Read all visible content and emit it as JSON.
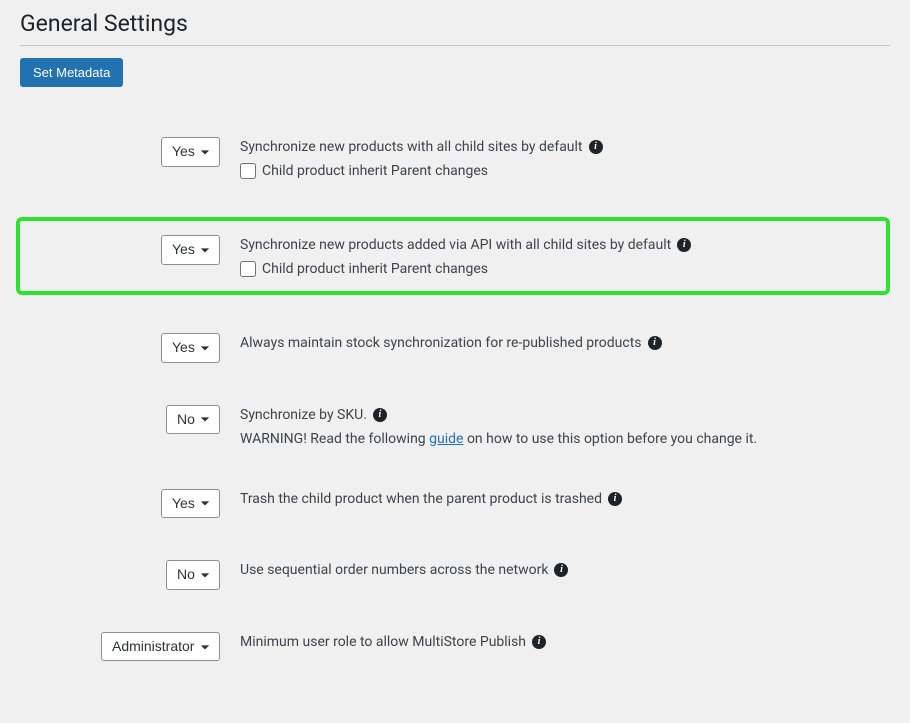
{
  "page_title": "General Settings",
  "button": {
    "set_metadata": "Set Metadata"
  },
  "select_options": {
    "yes": "Yes",
    "no": "No",
    "administrator": "Administrator"
  },
  "rows": {
    "sync_new": {
      "value": "Yes",
      "label": "Synchronize new products with all child sites by default",
      "checkbox_label": "Child product inherit Parent changes"
    },
    "sync_api": {
      "value": "Yes",
      "label": "Synchronize new products added via API with all child sites by default",
      "checkbox_label": "Child product inherit Parent changes"
    },
    "stock": {
      "value": "Yes",
      "label": "Always maintain stock synchronization for re-published products"
    },
    "sku": {
      "value": "No",
      "label": "Synchronize by SKU.",
      "warning_pre": "WARNING! Read the following ",
      "warning_link": "guide",
      "warning_post": " on how to use this option before you change it."
    },
    "trash": {
      "value": "Yes",
      "label": "Trash the child product when the parent product is trashed"
    },
    "seq": {
      "value": "No",
      "label": "Use sequential order numbers across the network"
    },
    "role": {
      "value": "Administrator",
      "label": "Minimum user role to allow MultiStore Publish"
    }
  }
}
